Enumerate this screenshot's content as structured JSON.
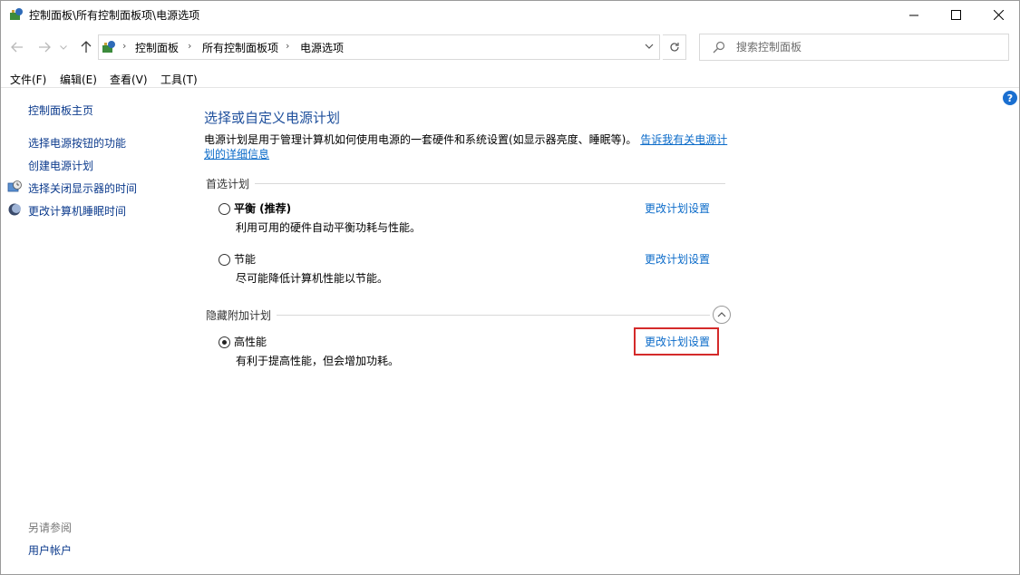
{
  "window": {
    "title": "控制面板\\所有控制面板项\\电源选项"
  },
  "address": {
    "crumbs": [
      "控制面板",
      "所有控制面板项",
      "电源选项"
    ]
  },
  "search": {
    "placeholder": "搜索控制面板"
  },
  "menu": [
    "文件(F)",
    "编辑(E)",
    "查看(V)",
    "工具(T)"
  ],
  "sidebar": {
    "home": "控制面板主页",
    "links": [
      "选择电源按钮的功能",
      "创建电源计划",
      "选择关闭显示器的时间",
      "更改计算机睡眠时间"
    ],
    "see_also_label": "另请参阅",
    "see_also_links": [
      "用户帐户"
    ]
  },
  "main": {
    "title": "选择或自定义电源计划",
    "description": "电源计划是用于管理计算机如何使用电源的一套硬件和系统设置(如显示器亮度、睡眠等)。",
    "description_link": "告诉我有关电源计划的详细信息",
    "preferred_label": "首选计划",
    "hidden_label": "隐藏附加计划",
    "plans": [
      {
        "name": "平衡 (推荐)",
        "desc": "利用可用的硬件自动平衡功耗与性能。",
        "link": "更改计划设置",
        "selected": false
      },
      {
        "name": "节能",
        "desc": "尽可能降低计算机性能以节能。",
        "link": "更改计划设置",
        "selected": false
      },
      {
        "name": "高性能",
        "desc": "有利于提高性能，但会增加功耗。",
        "link": "更改计划设置",
        "selected": true
      }
    ]
  },
  "colors": {
    "link": "#0b6bc9",
    "title_blue": "#1e4f9c",
    "highlight_red": "#d42a2a"
  }
}
